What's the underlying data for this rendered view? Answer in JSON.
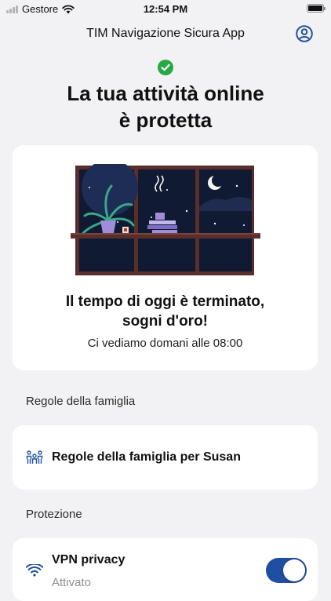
{
  "status_bar": {
    "carrier": "Gestore",
    "time": "12:54 PM"
  },
  "header": {
    "title": "TIM Navigazione Sicura App"
  },
  "hero": {
    "headline_line1": "La tua attività online",
    "headline_line2": "è protetta"
  },
  "card": {
    "message_line1": "Il tempo di oggi è terminato,",
    "message_line2": "sogni d'oro!",
    "subtitle": "Ci vediamo domani alle 08:00"
  },
  "family": {
    "section_label": "Regole della famiglia",
    "item_label": "Regole della famiglia per Susan"
  },
  "protection": {
    "section_label": "Protezione",
    "vpn_title": "VPN privacy",
    "vpn_status": "Attivato",
    "vpn_enabled": true
  },
  "colors": {
    "accent": "#1f4fa3",
    "success": "#27a844",
    "background": "#f2f2f4"
  }
}
